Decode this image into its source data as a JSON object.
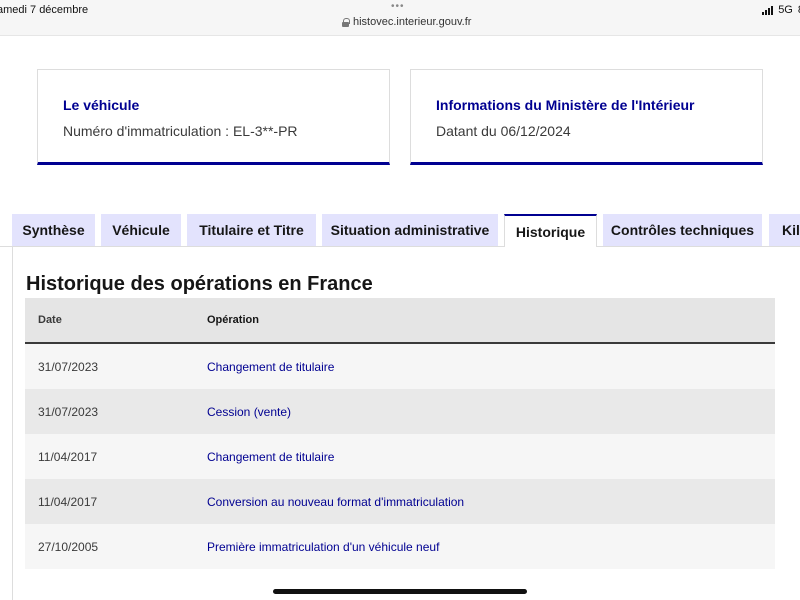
{
  "statusbar": {
    "date": "amedi 7 décembre",
    "url": "histovec.interieur.gouv.fr",
    "network": "5G",
    "battery": "8"
  },
  "cards": {
    "vehicle": {
      "title": "Le véhicule",
      "text": "Numéro d'immatriculation : EL-3**-PR"
    },
    "ministry": {
      "title": "Informations du Ministère de l'Intérieur",
      "text": "Datant du 06/12/2024"
    }
  },
  "tabs": [
    {
      "label": "Synthèse"
    },
    {
      "label": "Véhicule"
    },
    {
      "label": "Titulaire et Titre"
    },
    {
      "label": "Situation administrative"
    },
    {
      "label": "Historique"
    },
    {
      "label": "Contrôles techniques"
    },
    {
      "label": "Kilo"
    }
  ],
  "active_tab": "Historique",
  "history": {
    "title": "Historique des opérations en France",
    "columns": {
      "date": "Date",
      "operation": "Opération"
    },
    "rows": [
      {
        "date": "31/07/2023",
        "operation": "Changement de titulaire"
      },
      {
        "date": "31/07/2023",
        "operation": "Cession (vente)"
      },
      {
        "date": "11/04/2017",
        "operation": "Changement de titulaire"
      },
      {
        "date": "11/04/2017",
        "operation": "Conversion au nouveau format d'immatriculation"
      },
      {
        "date": "27/10/2005",
        "operation": "Première immatriculation d'un véhicule neuf"
      }
    ]
  },
  "colors": {
    "accent": "#000091",
    "tab_background": "#e3e3fd"
  }
}
